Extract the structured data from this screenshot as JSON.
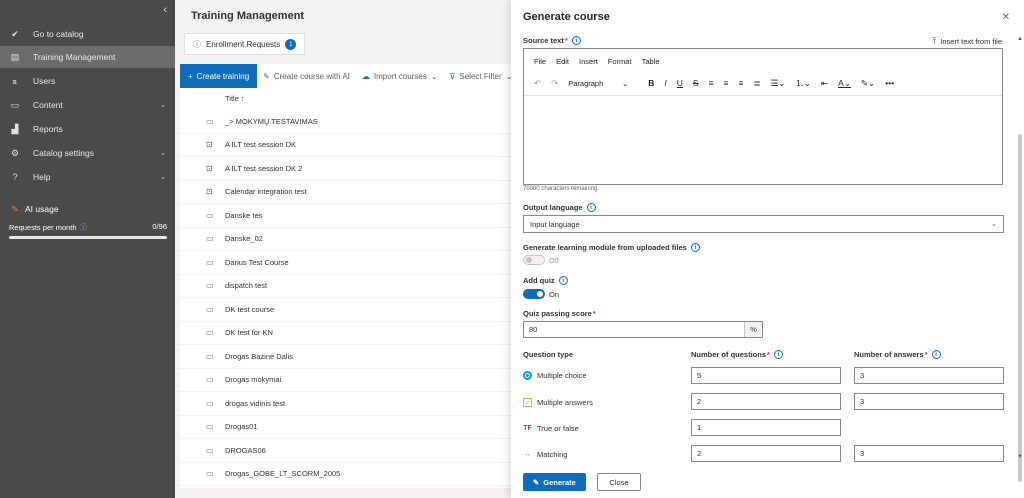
{
  "sidebar": {
    "items": [
      {
        "label": "Go to catalog",
        "icon": "check-circle-icon",
        "active": false,
        "chevron": false
      },
      {
        "label": "Training Management",
        "icon": "document-icon",
        "active": true,
        "chevron": false
      },
      {
        "label": "Users",
        "icon": "users-icon",
        "active": false,
        "chevron": false
      },
      {
        "label": "Content",
        "icon": "folder-icon",
        "active": false,
        "chevron": true
      },
      {
        "label": "Reports",
        "icon": "bar-chart-icon",
        "active": false,
        "chevron": false
      },
      {
        "label": "Catalog settings",
        "icon": "gear-icon",
        "active": false,
        "chevron": true
      },
      {
        "label": "Help",
        "icon": "question-icon",
        "active": false,
        "chevron": true
      }
    ],
    "ai_usage_label": "AI usage",
    "requests_label": "Requests per month",
    "requests_value": "0/96",
    "requests_fraction": 0.0
  },
  "main": {
    "title": "Training Management",
    "enrollment_tab": "Enrollment Requests",
    "enrollment_badge": "1",
    "toolbar": {
      "create": "Create training",
      "create_ai": "Create course with AI",
      "import": "Import courses",
      "filter": "Select Filter"
    },
    "column_title": "Title",
    "rows": [
      {
        "title": "_> MOKYMŲ TESTAVIMAS",
        "icon": "monitor-icon"
      },
      {
        "title": "A ILT test session DK",
        "icon": "classroom-icon"
      },
      {
        "title": "A ILT test session DK 2",
        "icon": "classroom-icon"
      },
      {
        "title": "Calendar integration test",
        "icon": "classroom-icon"
      },
      {
        "title": "Danske tes",
        "icon": "monitor-icon"
      },
      {
        "title": "Danske_02",
        "icon": "monitor-icon"
      },
      {
        "title": "Darius Test Course",
        "icon": "monitor-icon"
      },
      {
        "title": "dispatch test",
        "icon": "monitor-icon"
      },
      {
        "title": "DK test course",
        "icon": "monitor-icon"
      },
      {
        "title": "DK test for KN",
        "icon": "monitor-icon"
      },
      {
        "title": "Drogas Bazinė Dalis",
        "icon": "monitor-icon"
      },
      {
        "title": "Drogas mokymai",
        "icon": "monitor-icon"
      },
      {
        "title": "drogas vidinis test",
        "icon": "monitor-icon"
      },
      {
        "title": "Drogas01",
        "icon": "monitor-icon"
      },
      {
        "title": "DROGAS06",
        "icon": "monitor-icon"
      },
      {
        "title": "Drogas_GOBE_LT_SCORM_2005",
        "icon": "monitor-icon"
      }
    ]
  },
  "panel": {
    "title": "Generate course",
    "source_text_label": "Source text",
    "insert_link": "Insert text from file",
    "editor_menu": [
      "File",
      "Edit",
      "Insert",
      "Format",
      "Table"
    ],
    "paragraph": "Paragraph",
    "chars_remaining": "70000 characters remaining.",
    "output_language_label": "Output language",
    "output_language_placeholder": "Input language",
    "gen_module_label": "Generate learning module from uploaded files",
    "gen_module_state": "Off",
    "add_quiz_label": "Add quiz",
    "add_quiz_state": "On",
    "passing_score_label": "Quiz passing score",
    "passing_score": "80",
    "percent": "%",
    "question_type_header": "Question type",
    "num_questions_header": "Number of questions",
    "num_answers_header": "Number of answers",
    "question_types": [
      {
        "label": "Multiple choice",
        "questions": "5",
        "answers": "3"
      },
      {
        "label": "Multiple answers",
        "questions": "2",
        "answers": "3"
      },
      {
        "label": "True or false",
        "questions": "1",
        "answers": null
      },
      {
        "label": "Matching",
        "questions": "2",
        "answers": "3"
      }
    ],
    "generate_button": "Generate",
    "close_button": "Close",
    "accent": "#0f6cbd"
  }
}
